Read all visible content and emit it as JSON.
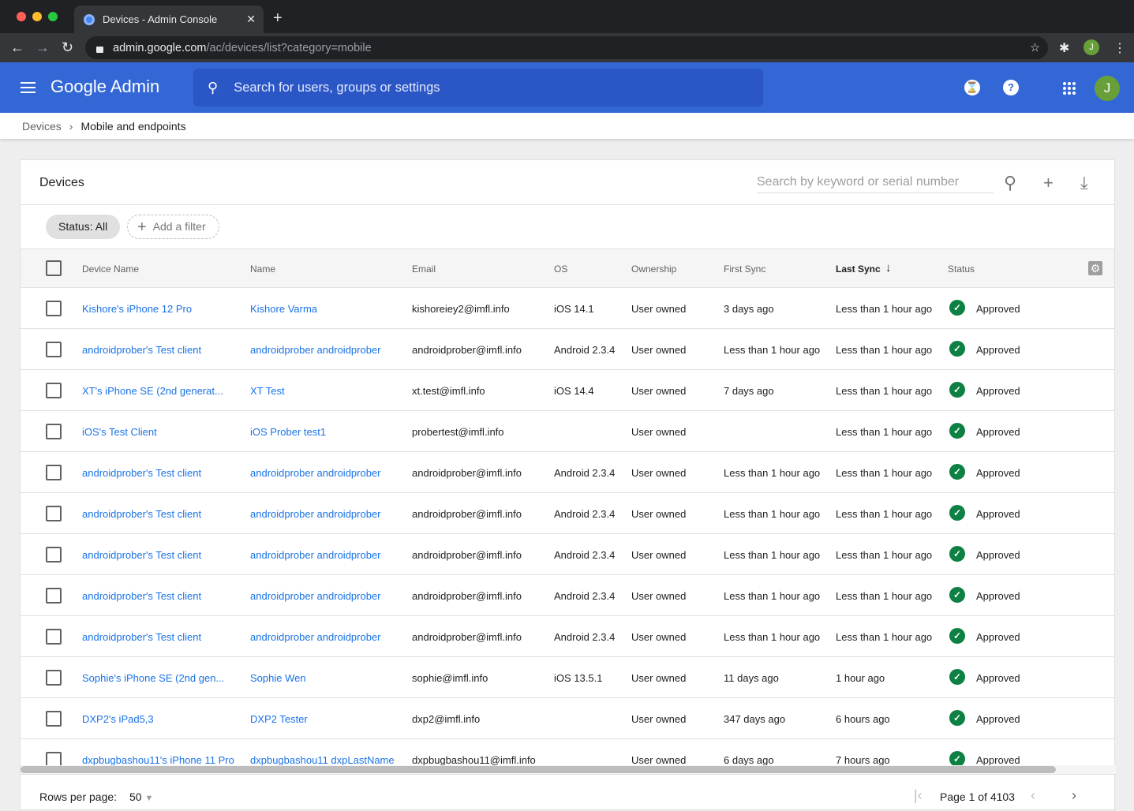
{
  "browser": {
    "tab_title": "Devices - Admin Console",
    "url_host": "admin.google.com",
    "url_path": "/ac/devices/list?category=mobile",
    "profile_initial": "J"
  },
  "appbar": {
    "logo": "Google Admin",
    "search_placeholder": "Search for users, groups or settings",
    "avatar_initial": "J"
  },
  "breadcrumb": {
    "parent": "Devices",
    "current": "Mobile and endpoints"
  },
  "card": {
    "title": "Devices",
    "search_placeholder": "Search by keyword or serial number"
  },
  "filters": {
    "status_chip": "Status: All",
    "add_filter": "Add a filter"
  },
  "columns": [
    "Device Name",
    "Name",
    "Email",
    "OS",
    "Ownership",
    "First Sync",
    "Last Sync",
    "Status"
  ],
  "sorted_column": "Last Sync",
  "colors": {
    "appbar": "#3367d6",
    "link": "#1a73e8",
    "approved": "#0d8043"
  },
  "rows": [
    {
      "device": "Kishore's iPhone 12 Pro",
      "name": "Kishore Varma",
      "email": "kishoreiey2@imfl.info",
      "os": "iOS 14.1",
      "ownership": "User owned",
      "first_sync": "3 days ago",
      "last_sync": "Less than 1 hour ago",
      "status": "Approved"
    },
    {
      "device": "androidprober's Test client",
      "name": "androidprober androidprober",
      "email": "androidprober@imfl.info",
      "os": "Android 2.3.4",
      "ownership": "User owned",
      "first_sync": "Less than 1 hour ago",
      "last_sync": "Less than 1 hour ago",
      "status": "Approved"
    },
    {
      "device": "XT's iPhone SE (2nd generat...",
      "name": "XT Test",
      "email": "xt.test@imfl.info",
      "os": "iOS 14.4",
      "ownership": "User owned",
      "first_sync": "7 days ago",
      "last_sync": "Less than 1 hour ago",
      "status": "Approved"
    },
    {
      "device": "iOS's Test Client",
      "name": "iOS Prober test1",
      "email": "probertest@imfl.info",
      "os": "",
      "ownership": "User owned",
      "first_sync": "",
      "last_sync": "Less than 1 hour ago",
      "status": "Approved"
    },
    {
      "device": "androidprober's Test client",
      "name": "androidprober androidprober",
      "email": "androidprober@imfl.info",
      "os": "Android 2.3.4",
      "ownership": "User owned",
      "first_sync": "Less than 1 hour ago",
      "last_sync": "Less than 1 hour ago",
      "status": "Approved"
    },
    {
      "device": "androidprober's Test client",
      "name": "androidprober androidprober",
      "email": "androidprober@imfl.info",
      "os": "Android 2.3.4",
      "ownership": "User owned",
      "first_sync": "Less than 1 hour ago",
      "last_sync": "Less than 1 hour ago",
      "status": "Approved"
    },
    {
      "device": "androidprober's Test client",
      "name": "androidprober androidprober",
      "email": "androidprober@imfl.info",
      "os": "Android 2.3.4",
      "ownership": "User owned",
      "first_sync": "Less than 1 hour ago",
      "last_sync": "Less than 1 hour ago",
      "status": "Approved"
    },
    {
      "device": "androidprober's Test client",
      "name": "androidprober androidprober",
      "email": "androidprober@imfl.info",
      "os": "Android 2.3.4",
      "ownership": "User owned",
      "first_sync": "Less than 1 hour ago",
      "last_sync": "Less than 1 hour ago",
      "status": "Approved"
    },
    {
      "device": "androidprober's Test client",
      "name": "androidprober androidprober",
      "email": "androidprober@imfl.info",
      "os": "Android 2.3.4",
      "ownership": "User owned",
      "first_sync": "Less than 1 hour ago",
      "last_sync": "Less than 1 hour ago",
      "status": "Approved"
    },
    {
      "device": "Sophie's iPhone SE (2nd gen...",
      "name": "Sophie Wen",
      "email": "sophie@imfl.info",
      "os": "iOS 13.5.1",
      "ownership": "User owned",
      "first_sync": "11 days ago",
      "last_sync": "1 hour ago",
      "status": "Approved"
    },
    {
      "device": "DXP2's iPad5,3",
      "name": "DXP2 Tester",
      "email": "dxp2@imfl.info",
      "os": "",
      "ownership": "User owned",
      "first_sync": "347 days ago",
      "last_sync": "6 hours ago",
      "status": "Approved"
    },
    {
      "device": "dxpbugbashou11's iPhone 11 Pro",
      "name": "dxpbugbashou11 dxpLastName",
      "email": "dxpbugbashou11@imfl.info",
      "os": "",
      "ownership": "User owned",
      "first_sync": "6 days ago",
      "last_sync": "7 hours ago",
      "status": "Approved"
    }
  ],
  "footer": {
    "rows_per_page_label": "Rows per page:",
    "rows_per_page": "50",
    "page_text": "Page 1 of 4103"
  }
}
